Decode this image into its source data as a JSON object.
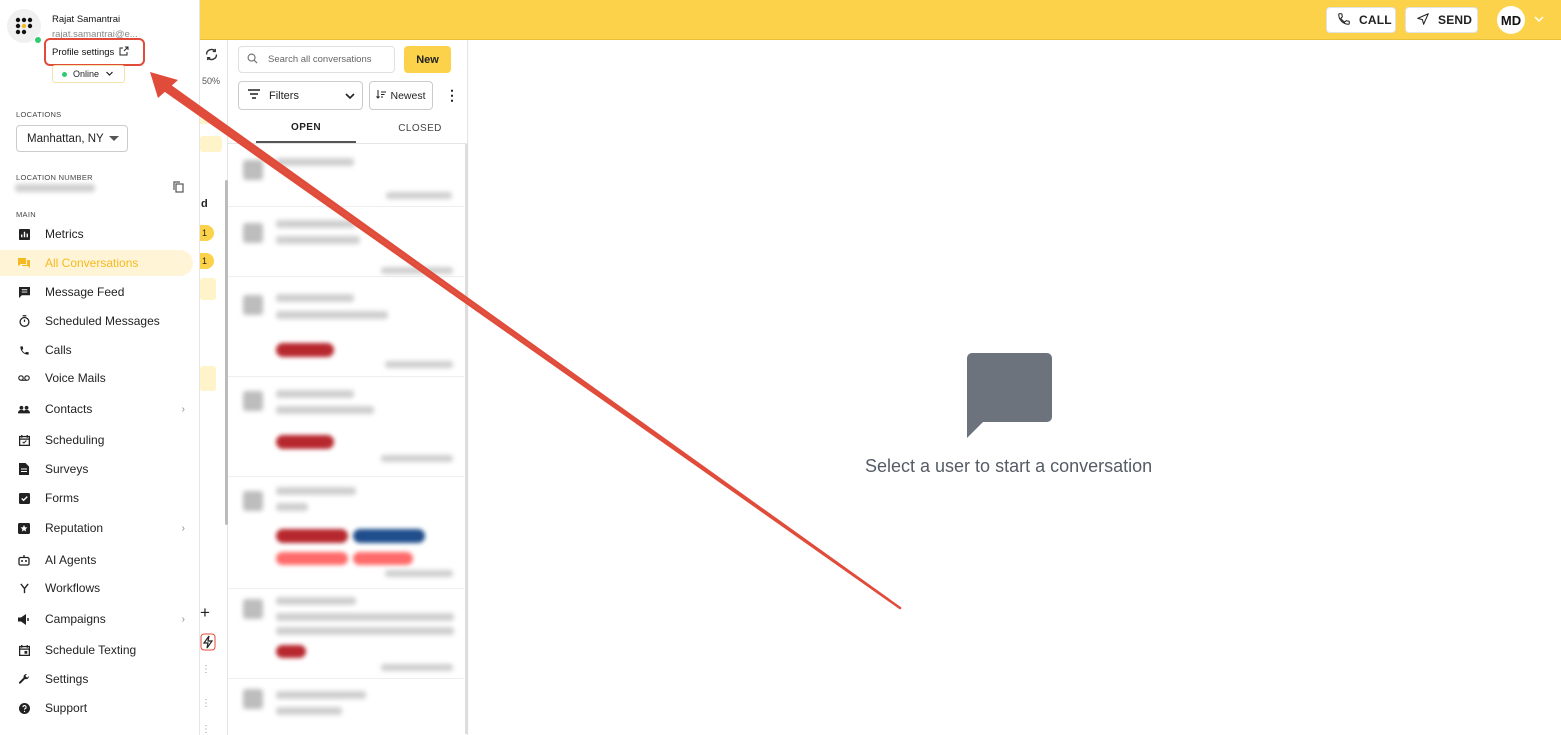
{
  "profile": {
    "name": "Rajat Samantrai",
    "email": "rajat.samantrai@e...",
    "settings_label": "Profile settings",
    "status": "Online",
    "status_color": "#2ecc71"
  },
  "sidebar": {
    "locations_label": "LOCATIONS",
    "location_value": "Manhattan, NY",
    "location_number_label": "LOCATION NUMBER",
    "main_label": "MAIN",
    "items": [
      {
        "label": "Metrics",
        "icon": "bar-chart-icon"
      },
      {
        "label": "All Conversations",
        "icon": "chat-bubbles-icon",
        "active": true
      },
      {
        "label": "Message Feed",
        "icon": "message-icon"
      },
      {
        "label": "Scheduled Messages",
        "icon": "timer-icon"
      },
      {
        "label": "Calls",
        "icon": "phone-icon"
      },
      {
        "label": "Voice Mails",
        "icon": "voicemail-icon"
      },
      {
        "label": "Contacts",
        "icon": "people-icon",
        "chevron": true
      },
      {
        "label": "Scheduling",
        "icon": "calendar-icon"
      },
      {
        "label": "Surveys",
        "icon": "document-icon"
      },
      {
        "label": "Forms",
        "icon": "checkbox-icon"
      },
      {
        "label": "Reputation",
        "icon": "star-box-icon",
        "chevron": true
      },
      {
        "label": "AI Agents",
        "icon": "robot-icon"
      },
      {
        "label": "Workflows",
        "icon": "workflow-icon"
      },
      {
        "label": "Campaigns",
        "icon": "megaphone-icon",
        "chevron": true
      },
      {
        "label": "Schedule Texting",
        "icon": "calendar-clock-icon"
      },
      {
        "label": "Settings",
        "icon": "wrench-icon"
      },
      {
        "label": "Support",
        "icon": "help-icon"
      }
    ],
    "chevron_glyph": "›"
  },
  "strip": {
    "percent": "50%",
    "letter": "d",
    "badge1": "1",
    "badge2": "1"
  },
  "convlist": {
    "search_placeholder": "Search all conversations",
    "new_label": "New",
    "filters_label": "Filters",
    "sort_label": "Newest",
    "tabs": [
      "OPEN",
      "CLOSED"
    ]
  },
  "topbar": {
    "call_label": "CALL",
    "send_label": "SEND",
    "avatar_initials": "MD"
  },
  "main": {
    "empty_message": "Select a user to start a conversation"
  },
  "colors": {
    "brand_yellow": "#fbd24a",
    "annotation_red": "#e04b3a"
  }
}
